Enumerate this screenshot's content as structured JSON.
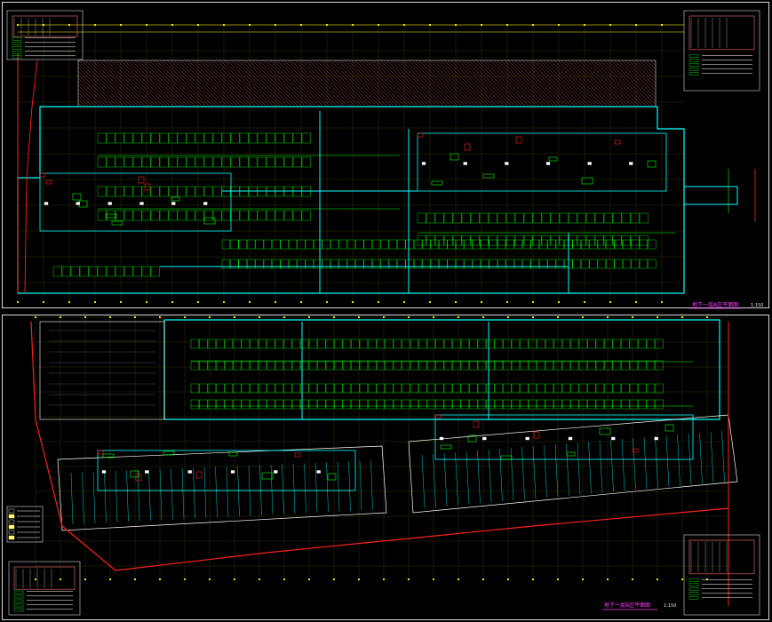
{
  "drawing": {
    "colors": {
      "background": "#000000",
      "frame": "#d8d8d8",
      "grid": "#ffff00",
      "parking": "#00ff00",
      "wall": "#00ffff",
      "boundary": "#ff1e1e",
      "title": "#ff3cff",
      "hatch": "#ff7070",
      "white": "#ffffff"
    },
    "sheets": [
      {
        "name": "upper-sheet",
        "title": "地下一层A区平面图",
        "scale": "1:150"
      },
      {
        "name": "lower-sheet",
        "title": "地下一层B区平面图",
        "scale": "1:150"
      }
    ]
  }
}
